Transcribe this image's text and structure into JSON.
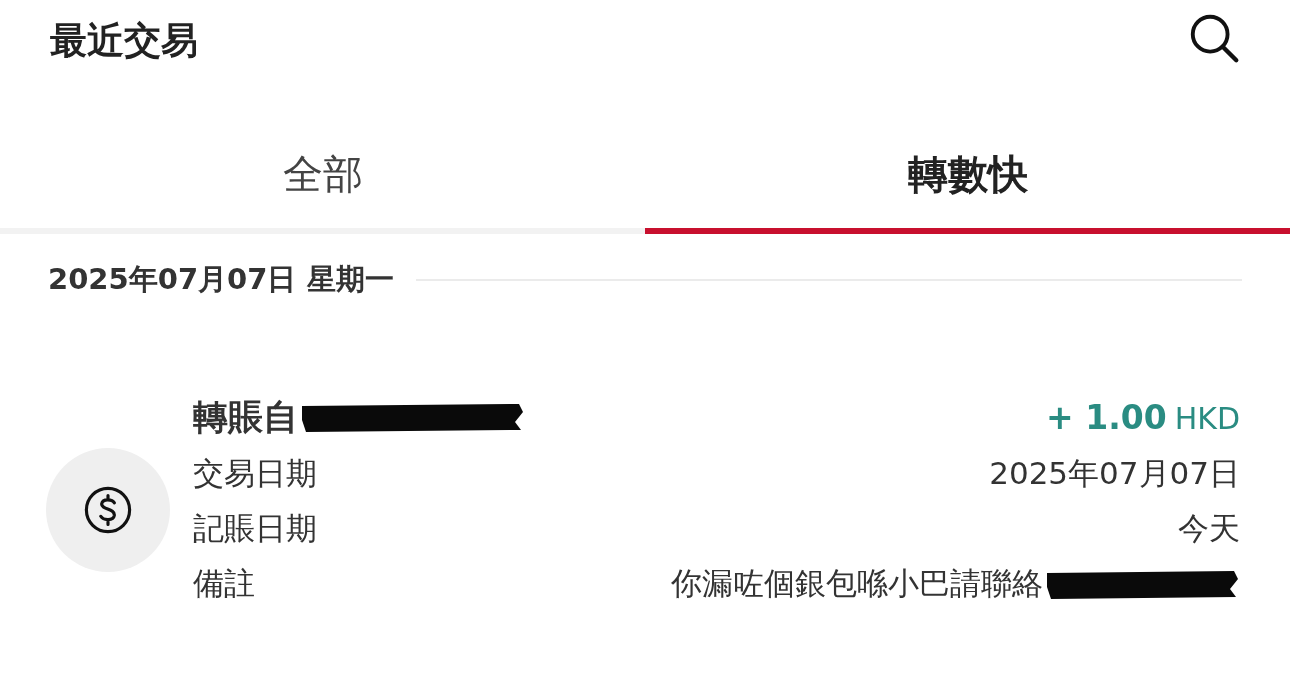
{
  "header": {
    "title": "最近交易"
  },
  "tabs": [
    {
      "label": "全部",
      "selected": false
    },
    {
      "label": "轉數快",
      "selected": true
    }
  ],
  "date_header": "2025年07月07日 星期一",
  "transactions": [
    {
      "title": "轉賬自",
      "title_redacted": true,
      "amount": "+ 1.00",
      "currency": "HKD",
      "details": [
        {
          "label": "交易日期",
          "value": "2025年07月07日",
          "redacted": false
        },
        {
          "label": "記賬日期",
          "value": "今天",
          "redacted": false
        },
        {
          "label": "備註",
          "value": "你漏咗個銀包喺小巴請聯絡",
          "redacted": true
        }
      ]
    }
  ]
}
